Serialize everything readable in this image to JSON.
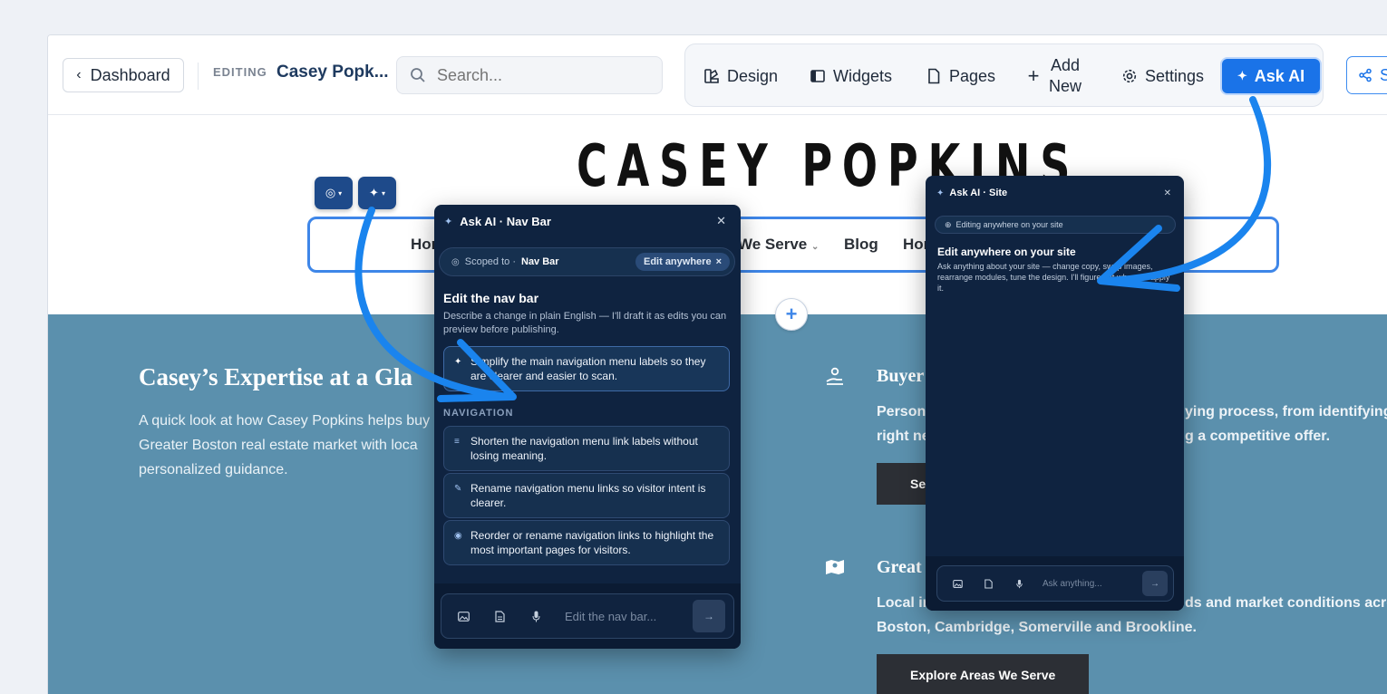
{
  "topbar": {
    "dashboard_label": "Dashboard",
    "editing_label": "EDITING",
    "site_name": "Casey Popk...",
    "search_placeholder": "Search...",
    "tools": {
      "design": "Design",
      "widgets": "Widgets",
      "pages": "Pages",
      "add_new_line1": "Add",
      "add_new_line2": "New",
      "settings": "Settings"
    },
    "ask_ai_label": "Ask AI",
    "share_label": "S"
  },
  "site": {
    "logo": "CASEY POPKINS",
    "nav": {
      "item_home_partial": "Hor",
      "item_we_serve": "We Serve",
      "item_blog": "Blog",
      "item_last_partial": "Hor"
    }
  },
  "content": {
    "expertise_title": "Casey’s Expertise at a Gla",
    "expertise_body": "A quick look at how Casey Popkins helps buy\nGreater Boston real estate market with loca\npersonalized guidance.",
    "buyer": {
      "title": "Buyer",
      "line1_left": "Persona",
      "line1_right": "ying process, from identifying t",
      "line2_left": "right ne",
      "line2_right": "g a competitive offer.",
      "button_partial": "Sea"
    },
    "greater": {
      "title": "Great",
      "line1_left": "Local in",
      "line1_right": "ds and market conditions acros",
      "line2": "Boston, Cambridge, Somerville and Brookline.",
      "button": "Explore Areas We Serve"
    }
  },
  "nav_panel": {
    "title": "Ask AI · Nav Bar",
    "scope_prefix": "Scoped to ·",
    "scope_target": "Nav Bar",
    "edit_anywhere_chip": "Edit anywhere",
    "heading": "Edit the nav bar",
    "description": "Describe a change in plain English — I'll draft it as edits you can preview before publishing.",
    "primary_suggestion": "Simplify the main navigation menu labels so they are clearer and easier to scan.",
    "section_label": "NAVIGATION",
    "suggestions": [
      "Shorten the navigation menu link labels without losing meaning.",
      "Rename navigation menu links so visitor intent is clearer.",
      "Reorder or rename navigation links to highlight the most important pages for visitors."
    ],
    "input_placeholder": "Edit the nav bar..."
  },
  "site_panel": {
    "title": "Ask AI · Site",
    "editing_chip": "Editing anywhere on your site",
    "heading": "Edit anywhere on your site",
    "description": "Ask anything about your site — change copy, swap images, rearrange modules, tune the design. I'll figure out where to apply it.",
    "input_placeholder": "Ask anything..."
  },
  "colors": {
    "accent": "#1a73e8",
    "panel_bg": "#0f2340",
    "content_bg": "#5b90ad",
    "arrow": "#1a84ee"
  }
}
